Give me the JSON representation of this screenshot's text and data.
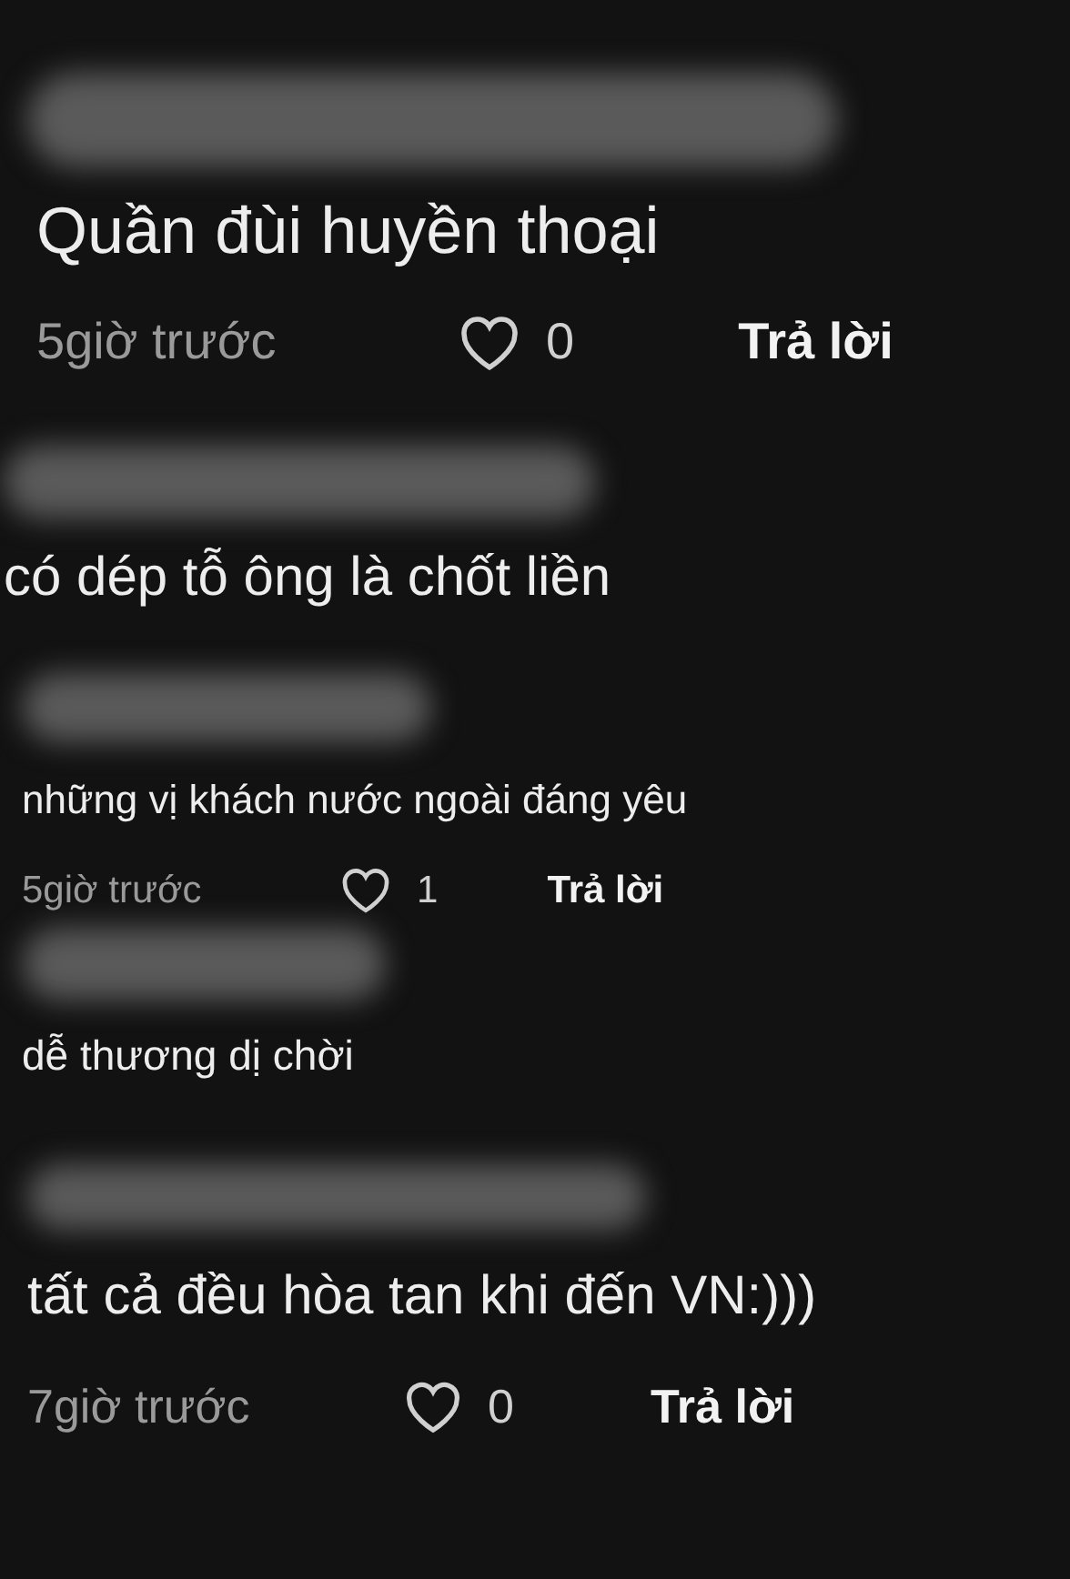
{
  "comments": [
    {
      "kind": "large",
      "text": "Quần đùi huyền thoại",
      "time": "5giờ trước",
      "likes": "0",
      "reply": "Trả lời"
    },
    {
      "kind": "large_text",
      "text": "có dép tỗ ông là chốt liền"
    },
    {
      "kind": "small",
      "text": "những vị khách nước ngoài đáng yêu",
      "time": "5giờ trước",
      "likes": "1",
      "reply": "Trả lời"
    },
    {
      "kind": "small_text",
      "text": "dễ thương dị chời"
    },
    {
      "kind": "medium",
      "text": "tất cả đều hòa tan khi đến VN:)))",
      "time": "7giờ trước",
      "likes": "0",
      "reply": "Trả lời"
    }
  ]
}
